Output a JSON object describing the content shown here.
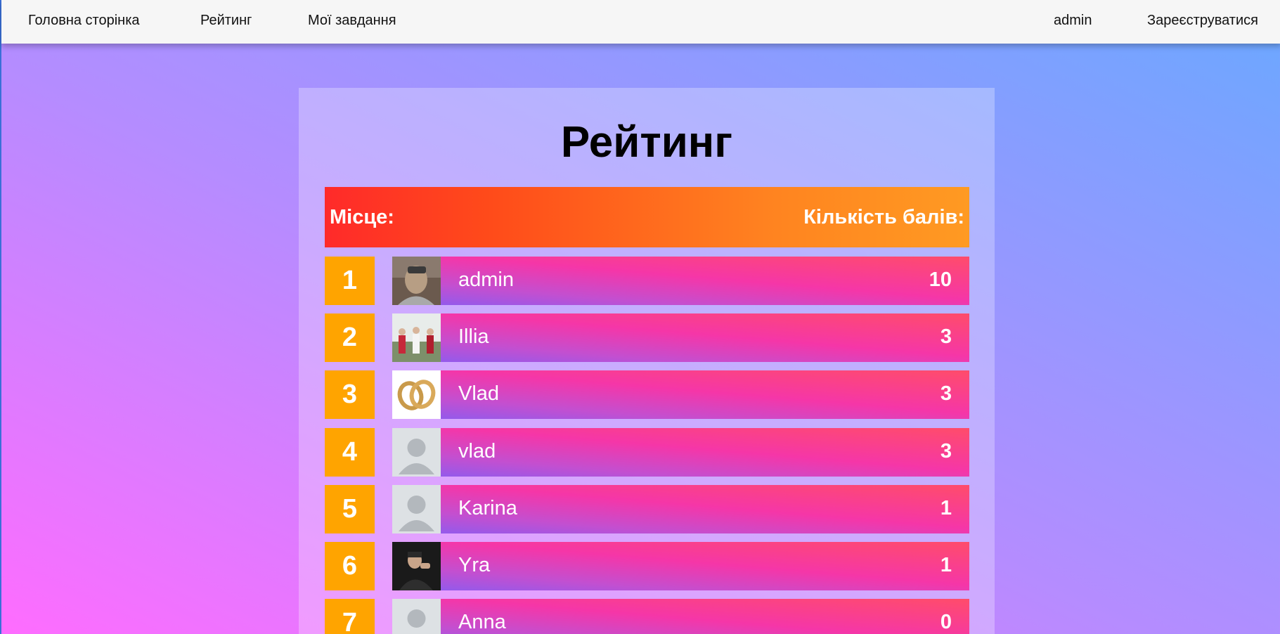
{
  "nav": {
    "home": "Головна сторінка",
    "rating": "Рейтинг",
    "tasks": "Мої завдання",
    "user": "admin",
    "register": "Зареєструватися"
  },
  "page": {
    "title": "Рейтинг",
    "col_place": "Місце:",
    "col_points": "Кількість балів:"
  },
  "rows": [
    {
      "rank": "1",
      "name": "admin",
      "score": "10",
      "avatar": "photo-person"
    },
    {
      "rank": "2",
      "name": "Illia",
      "score": "3",
      "avatar": "photo-group"
    },
    {
      "rank": "3",
      "name": "Vlad",
      "score": "3",
      "avatar": "photo-rings"
    },
    {
      "rank": "4",
      "name": "vlad",
      "score": "3",
      "avatar": "default-user-icon"
    },
    {
      "rank": "5",
      "name": "Karina",
      "score": "1",
      "avatar": "default-user-icon"
    },
    {
      "rank": "6",
      "name": "Yra",
      "score": "1",
      "avatar": "photo-dark"
    },
    {
      "rank": "7",
      "name": "Anna",
      "score": "0",
      "avatar": "default-user-icon"
    }
  ]
}
